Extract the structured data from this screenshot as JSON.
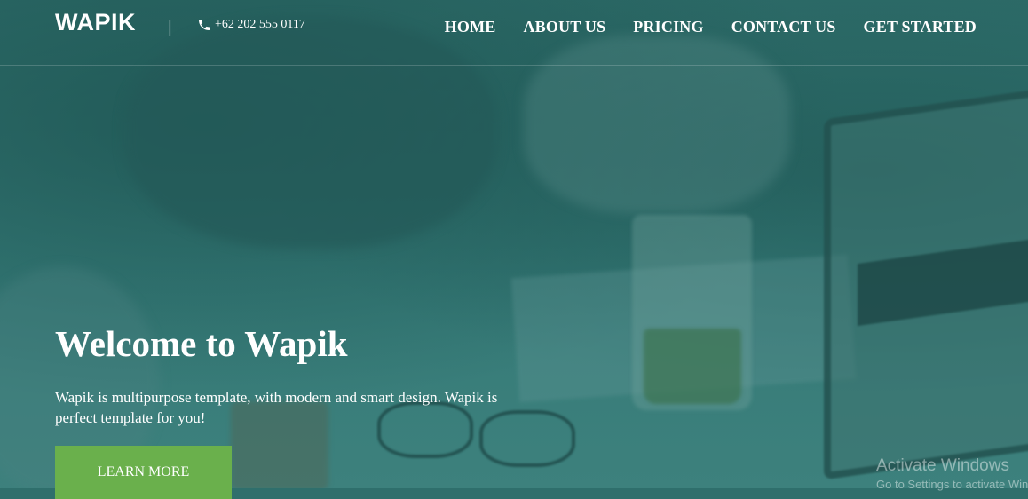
{
  "header": {
    "logo": "WAPIK",
    "separator": "|",
    "phone": {
      "icon": "phone-icon",
      "number": "+62 202 555 0117"
    },
    "nav": [
      {
        "label": "HOME"
      },
      {
        "label": "ABOUT US"
      },
      {
        "label": "PRICING"
      },
      {
        "label": "CONTACT US"
      },
      {
        "label": "GET STARTED"
      }
    ]
  },
  "hero": {
    "title": "Welcome to Wapik",
    "subtitle": "Wapik is multipurpose template, with modern and smart design. Wapik is perfect template for you!",
    "cta_label": "LEARN MORE"
  },
  "watermark": {
    "title": "Activate Windows",
    "subtitle": "Go to Settings to activate Windows."
  },
  "colors": {
    "overlay_teal": "#2f6f6c",
    "cta_green": "#6ab04c",
    "text": "#ffffff"
  }
}
